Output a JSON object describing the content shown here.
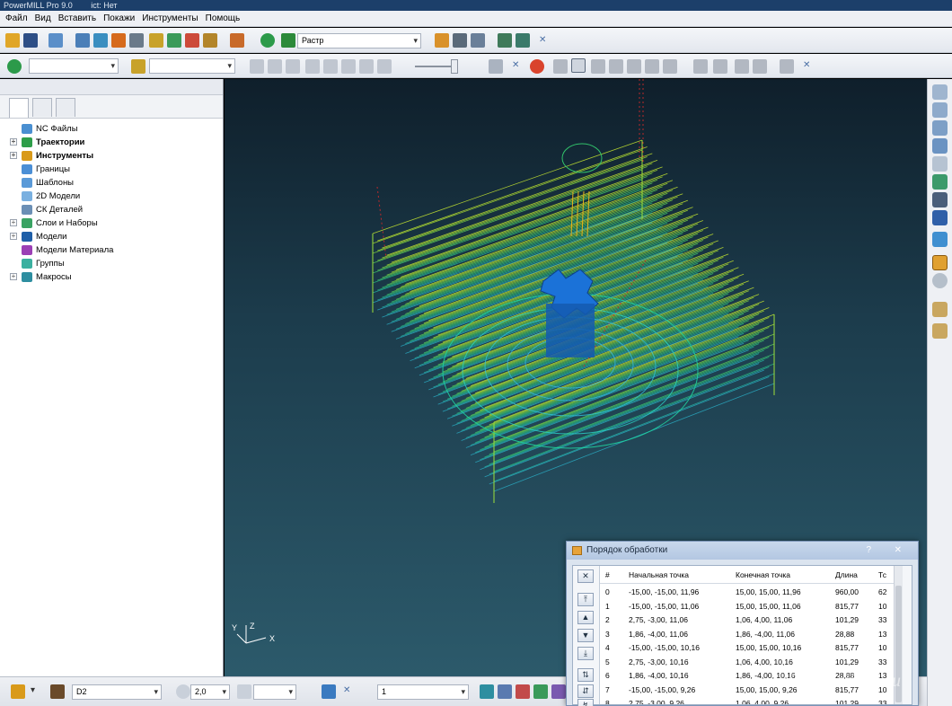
{
  "window": {
    "title": "PowerMILL Pro 9.0",
    "subtitle": "ict: Нет"
  },
  "menu": [
    "Файл",
    "Вид",
    "Вставить",
    "Покажи",
    "Инструменты",
    "Помощь"
  ],
  "toolbar": {
    "mode_select": "Растр",
    "tool_select": "D2",
    "diameter_value": "2,0",
    "count_select": "1"
  },
  "explorer": {
    "items": [
      {
        "label": "NC Файлы",
        "icon": "nc-files-icon",
        "color": "#4a8fd1",
        "expand": false,
        "bold": false
      },
      {
        "label": "Траектории",
        "icon": "toolpaths-icon",
        "color": "#2e9e4a",
        "expand": true,
        "bold": true
      },
      {
        "label": "Инструменты",
        "icon": "tools-icon",
        "color": "#d99a1a",
        "expand": true,
        "bold": true
      },
      {
        "label": "Границы",
        "icon": "boundaries-icon",
        "color": "#4b8fd6",
        "expand": false,
        "bold": false
      },
      {
        "label": "Шаблоны",
        "icon": "patterns-icon",
        "color": "#5a9ad8",
        "expand": false,
        "bold": false
      },
      {
        "label": "2D Модели",
        "icon": "2d-models-icon",
        "color": "#7ab0e0",
        "expand": false,
        "bold": false
      },
      {
        "label": "СК Деталей",
        "icon": "workplanes-icon",
        "color": "#6b8fb5",
        "expand": false,
        "bold": false
      },
      {
        "label": "Слои и Наборы",
        "icon": "layers-icon",
        "color": "#3aa363",
        "expand": true,
        "bold": false
      },
      {
        "label": "Модели",
        "icon": "models-icon",
        "color": "#1f5fa8",
        "expand": true,
        "bold": false
      },
      {
        "label": "Модели Материала",
        "icon": "stock-models-icon",
        "color": "#9b3fb5",
        "expand": false,
        "bold": false
      },
      {
        "label": "Группы",
        "icon": "groups-icon",
        "color": "#3bb0a0",
        "expand": false,
        "bold": false
      },
      {
        "label": "Макросы",
        "icon": "macros-icon",
        "color": "#2e8ea0",
        "expand": true,
        "bold": false
      }
    ]
  },
  "axes": {
    "x": "X",
    "y": "Y",
    "z": "Z"
  },
  "dialog": {
    "title": "Порядок обработки",
    "help": "?",
    "close": "✕",
    "columns": [
      "#",
      "Начальная точка",
      "Конечная точка",
      "Длина",
      "Тс"
    ],
    "rows": [
      [
        "0",
        "-15,00, -15,00, 11,96",
        "15,00, 15,00, 11,96",
        "960,00",
        "62"
      ],
      [
        "1",
        "-15,00, -15,00, 11,06",
        "15,00, 15,00, 11,06",
        "815,77",
        "10"
      ],
      [
        "2",
        "2,75, -3,00, 11,06",
        "1,06, 4,00, 11,06",
        "101,29",
        "33"
      ],
      [
        "3",
        "1,86, -4,00, 11,06",
        "1,86, -4,00, 11,06",
        "28,88",
        "13"
      ],
      [
        "4",
        "-15,00, -15,00, 10,16",
        "15,00, 15,00, 10,16",
        "815,77",
        "10"
      ],
      [
        "5",
        "2,75, -3,00, 10,16",
        "1,06, 4,00, 10,16",
        "101,29",
        "33"
      ],
      [
        "6",
        "1,86, -4,00, 10,16",
        "1,86, -4,00, 10,16",
        "28,88",
        "13"
      ],
      [
        "7",
        "-15,00, -15,00, 9,26",
        "15,00, 15,00, 9,26",
        "815,77",
        "10"
      ],
      [
        "8",
        "2,75, -3,00, 9,26",
        "1,06, 4,00, 9,26",
        "101,29",
        "33"
      ]
    ]
  },
  "watermark": "vSamodelkina.ru"
}
